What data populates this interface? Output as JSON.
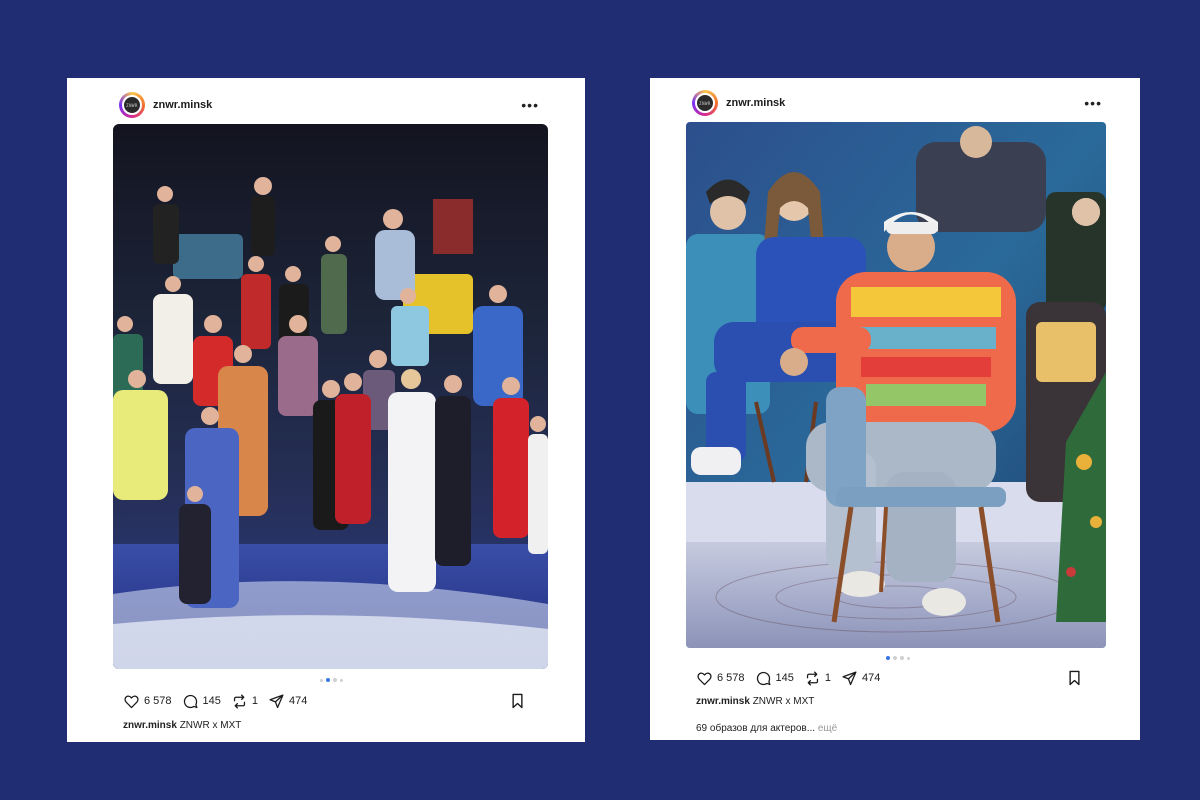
{
  "posts": [
    {
      "username": "znwr.minsk",
      "avatar_text": "ZNWR",
      "likes": "6 578",
      "comments": "145",
      "reposts": "1",
      "shares": "474",
      "caption_user": "znwr.minsk",
      "caption_text": "ZNWR x MXT",
      "carousel": {
        "count": 4,
        "active": 2
      }
    },
    {
      "username": "znwr.minsk",
      "avatar_text": "ZNWR",
      "likes": "6 578",
      "comments": "145",
      "reposts": "1",
      "shares": "474",
      "caption_user": "znwr.minsk",
      "caption_text": "ZNWR x MXT",
      "description": "69 образов для актеров...",
      "more_label": "ещё",
      "carousel": {
        "count": 4,
        "active": 1
      }
    }
  ],
  "colors": {
    "background": "#202d72",
    "card": "#ffffff",
    "carousel_active": "#3b74e6",
    "carousel_inactive": "#d0d0d0"
  },
  "icons": [
    "more-icon",
    "heart-icon",
    "comment-icon",
    "repost-icon",
    "share-icon",
    "bookmark-icon"
  ]
}
